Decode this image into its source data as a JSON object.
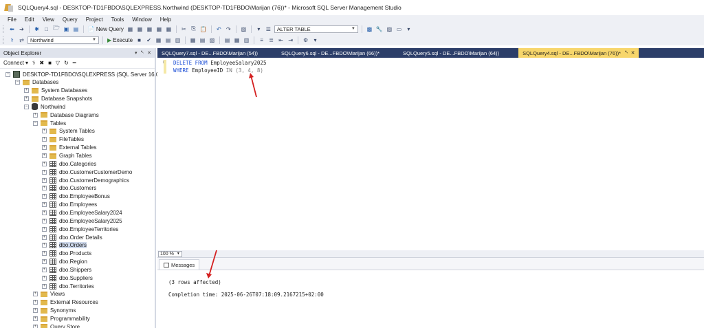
{
  "window": {
    "title": "SQLQuery4.sql - DESKTOP-TD1FBDO\\SQLEXPRESS.Northwind (DESKTOP-TD1FBDO\\Marijan (76))* - Microsoft SQL Server Management Studio"
  },
  "menu": [
    "File",
    "Edit",
    "View",
    "Query",
    "Project",
    "Tools",
    "Window",
    "Help"
  ],
  "toolbar": {
    "new_query_label": "New Query",
    "alter_table_value": "ALTER TABLE",
    "database_value": "Northwind",
    "execute_label": "Execute"
  },
  "object_explorer": {
    "title": "Object Explorer",
    "connect_label": "Connect",
    "tree": [
      {
        "label": "DESKTOP-TD1FBDO\\SQLEXPRESS (SQL Server 16.0.113",
        "icon": "server-icon",
        "level": 0,
        "expander": "minus"
      },
      {
        "label": "Databases",
        "icon": "folder-icon",
        "level": 1,
        "expander": "minus"
      },
      {
        "label": "System Databases",
        "icon": "folder-icon",
        "level": 2,
        "expander": "plus"
      },
      {
        "label": "Database Snapshots",
        "icon": "folder-icon",
        "level": 2,
        "expander": "plus"
      },
      {
        "label": "Northwind",
        "icon": "database-icon",
        "level": 2,
        "expander": "minus"
      },
      {
        "label": "Database Diagrams",
        "icon": "folder-icon",
        "level": 3,
        "expander": "plus"
      },
      {
        "label": "Tables",
        "icon": "folder-icon",
        "level": 3,
        "expander": "minus"
      },
      {
        "label": "System Tables",
        "icon": "folder-icon",
        "level": 4,
        "expander": "plus"
      },
      {
        "label": "FileTables",
        "icon": "folder-icon",
        "level": 4,
        "expander": "plus"
      },
      {
        "label": "External Tables",
        "icon": "folder-icon",
        "level": 4,
        "expander": "plus"
      },
      {
        "label": "Graph Tables",
        "icon": "folder-icon",
        "level": 4,
        "expander": "plus"
      },
      {
        "label": "dbo.Categories",
        "icon": "table-icon",
        "level": 4,
        "expander": "plus"
      },
      {
        "label": "dbo.CustomerCustomerDemo",
        "icon": "table-icon",
        "level": 4,
        "expander": "plus"
      },
      {
        "label": "dbo.CustomerDemographics",
        "icon": "table-icon",
        "level": 4,
        "expander": "plus"
      },
      {
        "label": "dbo.Customers",
        "icon": "table-icon",
        "level": 4,
        "expander": "plus"
      },
      {
        "label": "dbo.EmployeeBonus",
        "icon": "table-icon",
        "level": 4,
        "expander": "plus"
      },
      {
        "label": "dbo.Employees",
        "icon": "table-icon",
        "level": 4,
        "expander": "plus"
      },
      {
        "label": "dbo.EmployeeSalary2024",
        "icon": "table-icon",
        "level": 4,
        "expander": "plus"
      },
      {
        "label": "dbo.EmployeeSalary2025",
        "icon": "table-icon",
        "level": 4,
        "expander": "plus"
      },
      {
        "label": "dbo.EmployeeTerritories",
        "icon": "table-icon",
        "level": 4,
        "expander": "plus"
      },
      {
        "label": "dbo.Order Details",
        "icon": "table-icon",
        "level": 4,
        "expander": "plus"
      },
      {
        "label": "dbo.Orders",
        "icon": "table-icon",
        "level": 4,
        "expander": "plus",
        "selected": true
      },
      {
        "label": "dbo.Products",
        "icon": "table-icon",
        "level": 4,
        "expander": "plus"
      },
      {
        "label": "dbo.Region",
        "icon": "table-icon",
        "level": 4,
        "expander": "plus"
      },
      {
        "label": "dbo.Shippers",
        "icon": "table-icon",
        "level": 4,
        "expander": "plus"
      },
      {
        "label": "dbo.Suppliers",
        "icon": "table-icon",
        "level": 4,
        "expander": "plus"
      },
      {
        "label": "dbo.Territories",
        "icon": "table-icon",
        "level": 4,
        "expander": "plus"
      },
      {
        "label": "Views",
        "icon": "folder-icon",
        "level": 3,
        "expander": "plus"
      },
      {
        "label": "External Resources",
        "icon": "folder-icon",
        "level": 3,
        "expander": "plus"
      },
      {
        "label": "Synonyms",
        "icon": "folder-icon",
        "level": 3,
        "expander": "plus"
      },
      {
        "label": "Programmability",
        "icon": "folder-icon",
        "level": 3,
        "expander": "plus"
      },
      {
        "label": "Query Store",
        "icon": "folder-icon",
        "level": 3,
        "expander": "plus"
      }
    ]
  },
  "tabs": [
    {
      "label": "SQLQuery7.sql - DE...FBDO\\Marijan (54))",
      "active": false
    },
    {
      "label": "SQLQuery6.sql - DE...FBDO\\Marijan (66))*",
      "active": false
    },
    {
      "label": "SQLQuery5.sql - DE...FBDO\\Marijan (64))",
      "active": false
    },
    {
      "label": "SQLQuery4.sql - DE...FBDO\\Marijan (76))*",
      "active": true
    }
  ],
  "editor": {
    "line1": {
      "kw1": "DELETE",
      "kw2": "FROM",
      "ident": "EmployeeSalary2025"
    },
    "line2": {
      "kw1": "WHERE",
      "ident": "EmployeeID",
      "op": "IN",
      "values": "(3, 4, 8)"
    }
  },
  "zoom": "100 %",
  "results": {
    "tab_label": "Messages",
    "line1": "(3 rows affected)",
    "line2": "Completion time: 2025-06-26T07:18:09.2167215+02:00"
  },
  "colors": {
    "tab_strip": "#2c3e69",
    "active_tab": "#f7d66b",
    "keyword": "#1d4fd6",
    "annotation_arrow": "#d42020"
  }
}
